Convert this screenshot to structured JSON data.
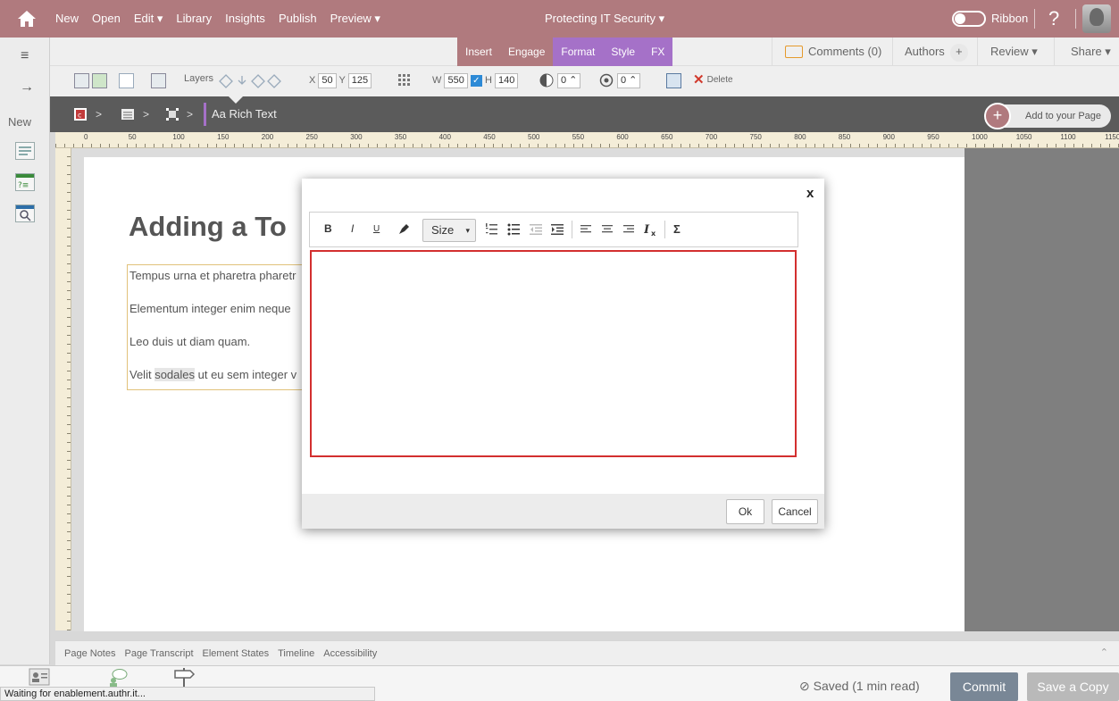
{
  "topbar": {
    "menu": {
      "new": "New",
      "open": "Open",
      "edit": "Edit ▾",
      "library": "Library",
      "insights": "Insights",
      "publish": "Publish",
      "preview": "Preview ▾"
    },
    "doc_title": "Protecting IT Security  ▾",
    "ribbon_label": "Ribbon",
    "help": "?"
  },
  "ribbon_tabs": {
    "insert": "Insert",
    "engage": "Engage",
    "format": "Format",
    "style": "Style",
    "fx": "FX"
  },
  "right_tabs": {
    "comments": "Comments (0)",
    "authors": "Authors",
    "authors_add": "+",
    "review": "Review ▾",
    "share": "Share ▾"
  },
  "left_strip": {
    "menu_glyph": "≡",
    "arrow_glyph": "→",
    "new_label": "New"
  },
  "toolbar": {
    "layers": "Layers",
    "x_label": "X",
    "x_value": "50",
    "y_label": "Y",
    "y_value": "125",
    "w_label": "W",
    "w_value": "550",
    "h_label": "H",
    "h_value": "140",
    "opacity_value": "0 ⌃",
    "rotation_value": "0 ⌃",
    "delete": "Delete"
  },
  "breadcrumb": {
    "sep": ">",
    "current": "Aa Rich Text",
    "add_button": "Add to your Page",
    "add_plus": "+"
  },
  "ruler_labels": [
    "0",
    "50",
    "100",
    "150",
    "200",
    "250",
    "300",
    "350",
    "400",
    "450",
    "500",
    "550",
    "600",
    "650",
    "700",
    "750",
    "800",
    "850",
    "900",
    "950",
    "1000",
    "1050",
    "1100",
    "1150"
  ],
  "page": {
    "heading": "Adding a To",
    "lines": [
      "Tempus urna et pharetra pharetr",
      "Elementum integer enim neque",
      "Leo duis ut diam quam.",
      "Velit "
    ],
    "highlighted_word": "sodales",
    "last_line_rest": " ut eu sem integer v"
  },
  "modal": {
    "close": "x",
    "bold": "B",
    "italic": "I",
    "underline": "U",
    "size_label": "Size",
    "size_caret": "▾",
    "sigma": "Σ",
    "ok": "Ok",
    "cancel": "Cancel"
  },
  "bottom_tabs": {
    "notes": "Page Notes",
    "transcript": "Page Transcript",
    "states": "Element States",
    "timeline": "Timeline",
    "accessibility": "Accessibility",
    "collapse": "⌃"
  },
  "footer": {
    "saved": "⊘  Saved (1 min read)",
    "commit": "Commit",
    "save_copy": "Save a Copy",
    "status": "Waiting for enablement.authr.it..."
  },
  "colors": {
    "topbar": "#b07a7e",
    "format_tab": "#a571c8",
    "editor_border": "#d32f2f",
    "commit": "#798796"
  }
}
